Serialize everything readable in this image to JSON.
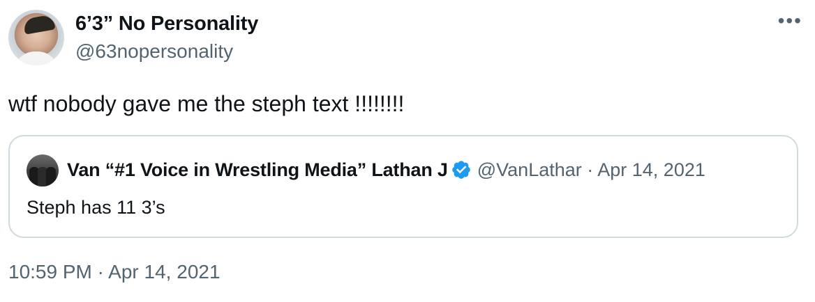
{
  "author": {
    "name": "6’3” No Personality",
    "handle": "@63nopersonality"
  },
  "tweet": {
    "text": "wtf nobody gave me the steph text !!!!!!!!",
    "timestamp": "10:59 PM · Apr 14, 2021"
  },
  "more_icon": "more-horizontal-icon",
  "quote": {
    "name": "Van “#1 Voice in Wrestling Media” Lathan J",
    "verified_icon": "verified-badge-icon",
    "meta": "@VanLathar · Apr 14, 2021",
    "text": "Steph has 11 3’s"
  },
  "colors": {
    "text": "#0f1419",
    "secondary": "#536471",
    "border": "#cfd9de",
    "verified": "#1d9bf0"
  }
}
